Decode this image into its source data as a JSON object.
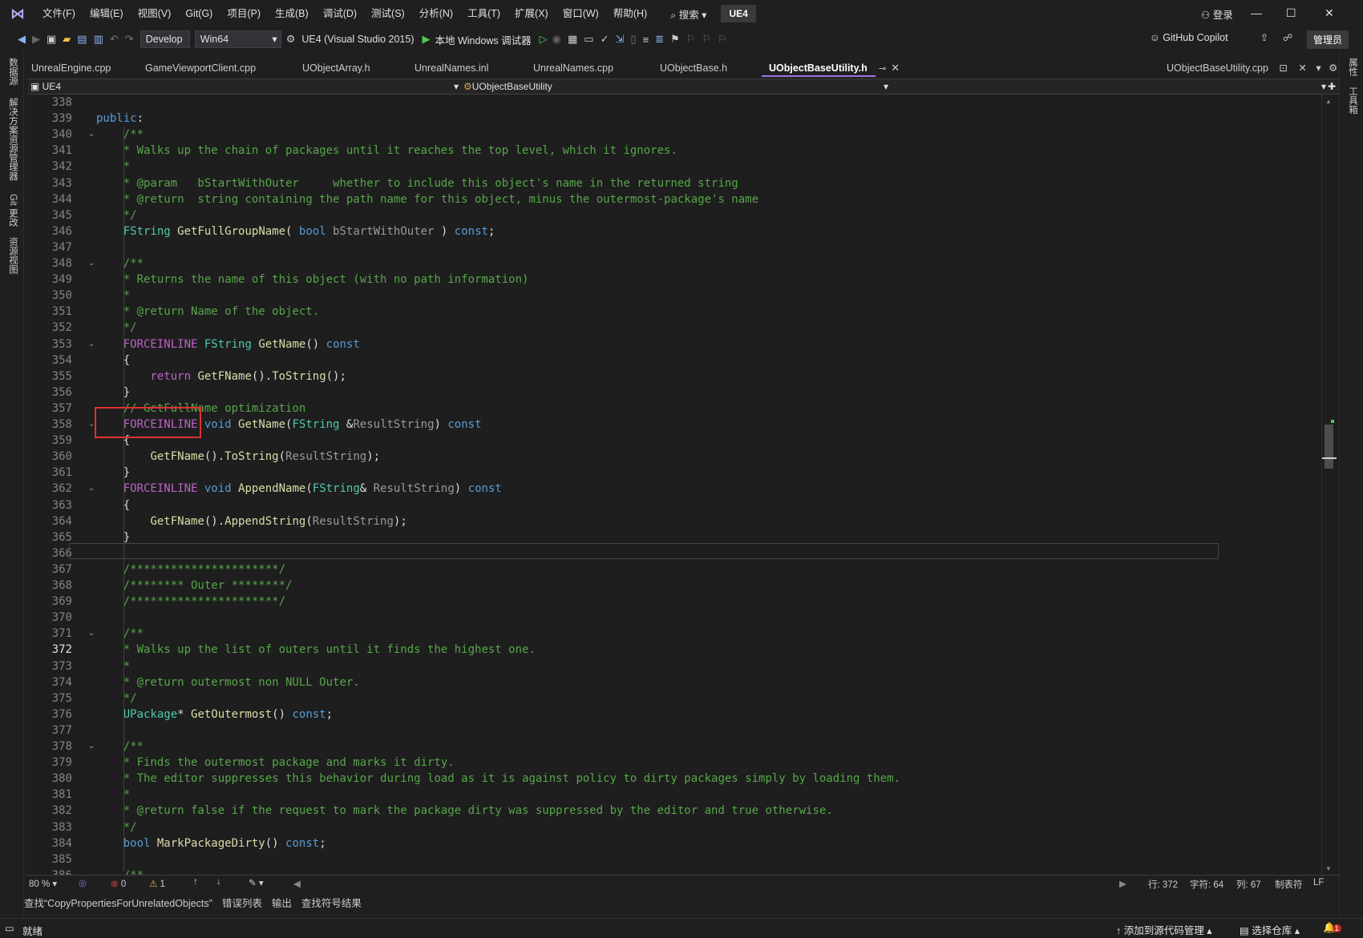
{
  "title_menu": [
    "文件(F)",
    "编辑(E)",
    "视图(V)",
    "Git(G)",
    "项目(P)",
    "生成(B)",
    "调试(D)",
    "测试(S)",
    "分析(N)",
    "工具(T)",
    "扩展(X)",
    "窗口(W)",
    "帮助(H)"
  ],
  "search_label": "搜索",
  "solution_name": "UE4",
  "login_label": "登录",
  "toolbar": {
    "config": "Develop",
    "platform": "Win64",
    "startup": "UE4 (Visual Studio 2015)",
    "debugger": "本地 Windows 调试器",
    "copilot": "GitHub Copilot",
    "admin": "管理员"
  },
  "left_tabs": [
    "数据源",
    "解决方案资源管理器",
    "Git 更改",
    "资源视图"
  ],
  "right_tabs": [
    "属性",
    "工具箱"
  ],
  "tabs": [
    "UnrealEngine.cpp",
    "GameViewportClient.cpp",
    "UObjectArray.h",
    "UnrealNames.inl",
    "UnrealNames.cpp",
    "UObjectBase.h",
    "UObjectBaseUtility.h"
  ],
  "preview_tab": "UObjectBaseUtility.cpp",
  "nav": {
    "project": "UE4",
    "scope": "UObjectBaseUtility"
  },
  "line_numbers": [
    "338",
    "339",
    "340",
    "341",
    "342",
    "343",
    "344",
    "345",
    "346",
    "347",
    "348",
    "349",
    "350",
    "351",
    "352",
    "353",
    "354",
    "355",
    "356",
    "357",
    "358",
    "359",
    "360",
    "361",
    "362",
    "363",
    "364",
    "365",
    "366",
    "367",
    "368",
    "369",
    "370",
    "371",
    "372",
    "373",
    "374",
    "375",
    "376",
    "377",
    "378",
    "379",
    "380",
    "381",
    "382",
    "383",
    "384",
    "385",
    "386"
  ],
  "current_line": "372",
  "status_row": {
    "zoom": "80 %",
    "errors": "0",
    "warnings": "1",
    "row": "行: 372",
    "char": "字符: 64",
    "col": "列: 67",
    "tab": "制表符",
    "eol": "LF"
  },
  "bottom_tabs": [
    "查找“CopyPropertiesForUnrelatedObjects”",
    "错误列表",
    "输出",
    "查找符号结果"
  ],
  "statusbar": {
    "ready": "就绪",
    "source_control": "添加到源代码管理",
    "repo": "选择仓库",
    "notifications": "1"
  }
}
